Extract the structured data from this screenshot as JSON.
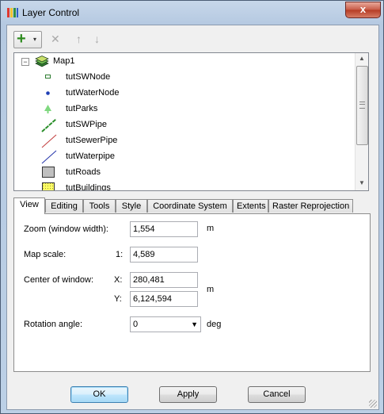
{
  "window": {
    "title": "Layer Control",
    "close_glyph": "x"
  },
  "toolbar": {
    "add_icon": "add-layer-icon",
    "add_glyph": "+",
    "dropdown_glyph": "▾",
    "remove_glyph": "✕",
    "up_glyph": "↑",
    "down_glyph": "↓"
  },
  "tree": {
    "expander": "−",
    "root": "Map1",
    "layers": [
      {
        "name": "tutSWNode",
        "symbol": "square-node",
        "color": "#2e7d32"
      },
      {
        "name": "tutWaterNode",
        "symbol": "dot",
        "color": "#1f3fb5"
      },
      {
        "name": "tutParks",
        "symbol": "tree",
        "color": "#7fd87f"
      },
      {
        "name": "tutSWPipe",
        "symbol": "line",
        "color": "#2a8f2a"
      },
      {
        "name": "tutSewerPipe",
        "symbol": "line",
        "color": "#c23b3b"
      },
      {
        "name": "tutWaterpipe",
        "symbol": "line",
        "color": "#2233aa"
      },
      {
        "name": "tutRoads",
        "symbol": "fill",
        "color": "#c0c0c0"
      },
      {
        "name": "tutBuildings",
        "symbol": "fill",
        "color": "#ffff66"
      }
    ]
  },
  "tabs": [
    "View",
    "Editing",
    "Tools",
    "Style",
    "Coordinate System",
    "Extents",
    "Raster Reprojection"
  ],
  "active_tab": "View",
  "view": {
    "zoom_label": "Zoom (window width):",
    "zoom_value": "1,554",
    "zoom_unit": "m",
    "scale_label": "Map scale:",
    "scale_prefix": "1:",
    "scale_value": "4,589",
    "center_label": "Center of window:",
    "x_label": "X:",
    "x_value": "280,481",
    "y_label": "Y:",
    "y_value": "6,124,594",
    "center_unit": "m",
    "rotation_label": "Rotation angle:",
    "rotation_value": "0",
    "rotation_unit": "deg"
  },
  "buttons": {
    "ok": "OK",
    "apply": "Apply",
    "cancel": "Cancel"
  }
}
